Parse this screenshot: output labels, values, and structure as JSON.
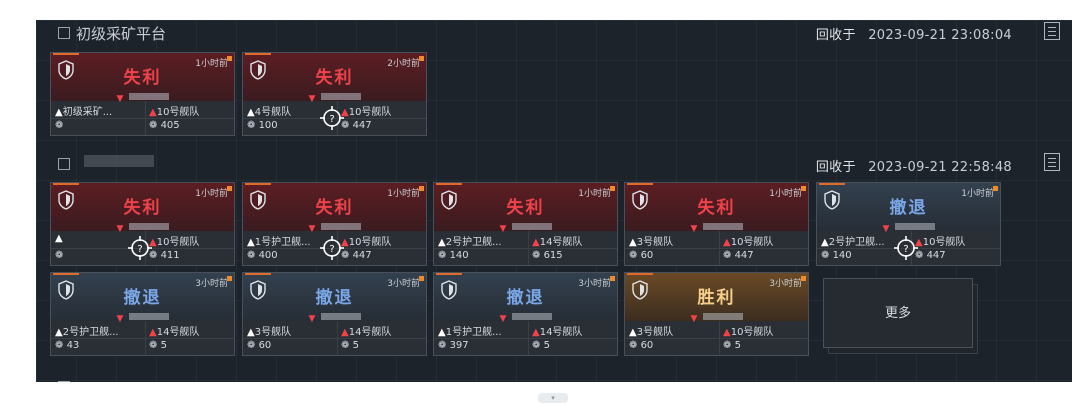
{
  "sections": [
    {
      "title": "初级采矿平台",
      "received_label": "回收于",
      "received_time": "2023-09-21 23:08:04"
    },
    {
      "title": "",
      "received_label": "回收于",
      "received_time": "2023-09-21 22:58:48"
    },
    {
      "title": "",
      "received_label": "",
      "received_time": ""
    }
  ],
  "cards": [
    {
      "result": "失利",
      "time": "1小时前",
      "left1": "初级采矿...",
      "right1": "10号舰队",
      "left2": "",
      "right2": "405"
    },
    {
      "result": "失利",
      "time": "2小时前",
      "left1": "4号舰队",
      "right1": "10号舰队",
      "left2": "100",
      "right2": "447"
    },
    {
      "result": "失利",
      "time": "1小时前",
      "left1": "",
      "right1": "10号舰队",
      "left2": "",
      "right2": "411"
    },
    {
      "result": "失利",
      "time": "1小时前",
      "left1": "1号护卫舰...",
      "right1": "10号舰队",
      "left2": "400",
      "right2": "447"
    },
    {
      "result": "失利",
      "time": "1小时前",
      "left1": "2号护卫舰...",
      "right1": "14号舰队",
      "left2": "140",
      "right2": "615"
    },
    {
      "result": "失利",
      "time": "1小时前",
      "left1": "3号舰队",
      "right1": "10号舰队",
      "left2": "60",
      "right2": "447"
    },
    {
      "result": "撤退",
      "time": "1小时前",
      "left1": "2号护卫舰...",
      "right1": "10号舰队",
      "left2": "140",
      "right2": "447"
    },
    {
      "result": "撤退",
      "time": "3小时前",
      "left1": "2号护卫舰...",
      "right1": "14号舰队",
      "left2": "43",
      "right2": "5"
    },
    {
      "result": "撤退",
      "time": "3小时前",
      "left1": "3号舰队",
      "right1": "14号舰队",
      "left2": "60",
      "right2": "5"
    },
    {
      "result": "撤退",
      "time": "3小时前",
      "left1": "1号护卫舰...",
      "right1": "14号舰队",
      "left2": "397",
      "right2": "5"
    },
    {
      "result": "胜利",
      "time": "3小时前",
      "left1": "3号舰队",
      "right1": "10号舰队",
      "left2": "60",
      "right2": "5"
    }
  ],
  "more_label": "更多",
  "icons": {
    "shield": "shield-icon",
    "unknown": "question-target-icon",
    "doc": "document-icon",
    "handle": "chevron-down-icon"
  },
  "colors": {
    "loss": "#f0424a",
    "retreat": "#7aa7e8",
    "win": "#f6cf8a",
    "accent": "#e06a2a"
  }
}
